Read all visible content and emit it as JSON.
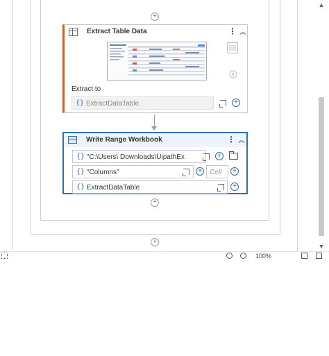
{
  "extract_table": {
    "title": "Extract Table Data",
    "extract_to_label": "Extract to",
    "extract_to_value": "ExtractDataTable"
  },
  "write_range": {
    "title": "Write Range Workbook",
    "path_value": "\"C:\\Users\\        Downloads\\UipathEx",
    "sheet_value": "\"Columns\"",
    "cell_placeholder": "Cell",
    "datatable_value": "ExtractDataTable"
  },
  "icons": {
    "extract_card": "table-extract-icon",
    "write_card": "excel-write-icon",
    "variable": "curly-braces-icon",
    "expand": "expand-editor-icon",
    "add": "plus-circle-icon",
    "browse": "folder-icon",
    "more": "kebab-menu-icon",
    "collapse": "chevron-up-double-icon"
  },
  "colors": {
    "extract_accent": "#e2571e",
    "selected_border": "#2e6fb7",
    "variable_brace": "#2b6cb0"
  },
  "status_bar": {
    "text": "",
    "zoom": "100%"
  }
}
